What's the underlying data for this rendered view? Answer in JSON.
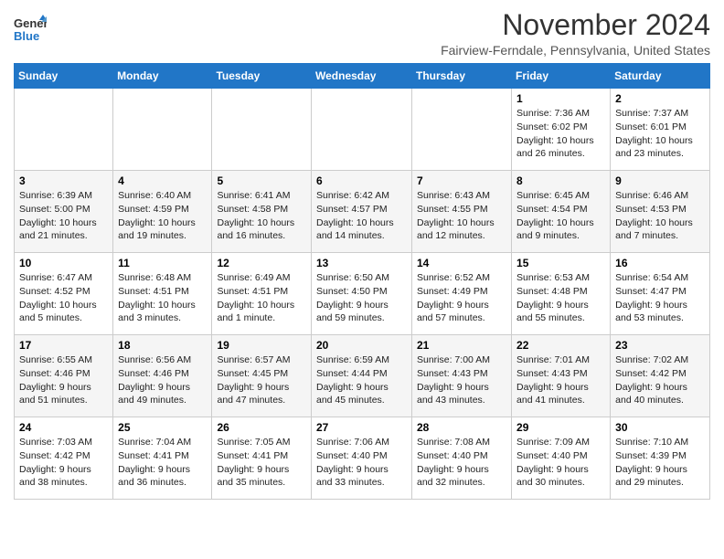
{
  "logo": {
    "line1": "General",
    "line2": "Blue"
  },
  "title": "November 2024",
  "location": "Fairview-Ferndale, Pennsylvania, United States",
  "days_of_week": [
    "Sunday",
    "Monday",
    "Tuesday",
    "Wednesday",
    "Thursday",
    "Friday",
    "Saturday"
  ],
  "weeks": [
    [
      {
        "day": "",
        "info": ""
      },
      {
        "day": "",
        "info": ""
      },
      {
        "day": "",
        "info": ""
      },
      {
        "day": "",
        "info": ""
      },
      {
        "day": "",
        "info": ""
      },
      {
        "day": "1",
        "info": "Sunrise: 7:36 AM\nSunset: 6:02 PM\nDaylight: 10 hours and 26 minutes."
      },
      {
        "day": "2",
        "info": "Sunrise: 7:37 AM\nSunset: 6:01 PM\nDaylight: 10 hours and 23 minutes."
      }
    ],
    [
      {
        "day": "3",
        "info": "Sunrise: 6:39 AM\nSunset: 5:00 PM\nDaylight: 10 hours and 21 minutes."
      },
      {
        "day": "4",
        "info": "Sunrise: 6:40 AM\nSunset: 4:59 PM\nDaylight: 10 hours and 19 minutes."
      },
      {
        "day": "5",
        "info": "Sunrise: 6:41 AM\nSunset: 4:58 PM\nDaylight: 10 hours and 16 minutes."
      },
      {
        "day": "6",
        "info": "Sunrise: 6:42 AM\nSunset: 4:57 PM\nDaylight: 10 hours and 14 minutes."
      },
      {
        "day": "7",
        "info": "Sunrise: 6:43 AM\nSunset: 4:55 PM\nDaylight: 10 hours and 12 minutes."
      },
      {
        "day": "8",
        "info": "Sunrise: 6:45 AM\nSunset: 4:54 PM\nDaylight: 10 hours and 9 minutes."
      },
      {
        "day": "9",
        "info": "Sunrise: 6:46 AM\nSunset: 4:53 PM\nDaylight: 10 hours and 7 minutes."
      }
    ],
    [
      {
        "day": "10",
        "info": "Sunrise: 6:47 AM\nSunset: 4:52 PM\nDaylight: 10 hours and 5 minutes."
      },
      {
        "day": "11",
        "info": "Sunrise: 6:48 AM\nSunset: 4:51 PM\nDaylight: 10 hours and 3 minutes."
      },
      {
        "day": "12",
        "info": "Sunrise: 6:49 AM\nSunset: 4:51 PM\nDaylight: 10 hours and 1 minute."
      },
      {
        "day": "13",
        "info": "Sunrise: 6:50 AM\nSunset: 4:50 PM\nDaylight: 9 hours and 59 minutes."
      },
      {
        "day": "14",
        "info": "Sunrise: 6:52 AM\nSunset: 4:49 PM\nDaylight: 9 hours and 57 minutes."
      },
      {
        "day": "15",
        "info": "Sunrise: 6:53 AM\nSunset: 4:48 PM\nDaylight: 9 hours and 55 minutes."
      },
      {
        "day": "16",
        "info": "Sunrise: 6:54 AM\nSunset: 4:47 PM\nDaylight: 9 hours and 53 minutes."
      }
    ],
    [
      {
        "day": "17",
        "info": "Sunrise: 6:55 AM\nSunset: 4:46 PM\nDaylight: 9 hours and 51 minutes."
      },
      {
        "day": "18",
        "info": "Sunrise: 6:56 AM\nSunset: 4:46 PM\nDaylight: 9 hours and 49 minutes."
      },
      {
        "day": "19",
        "info": "Sunrise: 6:57 AM\nSunset: 4:45 PM\nDaylight: 9 hours and 47 minutes."
      },
      {
        "day": "20",
        "info": "Sunrise: 6:59 AM\nSunset: 4:44 PM\nDaylight: 9 hours and 45 minutes."
      },
      {
        "day": "21",
        "info": "Sunrise: 7:00 AM\nSunset: 4:43 PM\nDaylight: 9 hours and 43 minutes."
      },
      {
        "day": "22",
        "info": "Sunrise: 7:01 AM\nSunset: 4:43 PM\nDaylight: 9 hours and 41 minutes."
      },
      {
        "day": "23",
        "info": "Sunrise: 7:02 AM\nSunset: 4:42 PM\nDaylight: 9 hours and 40 minutes."
      }
    ],
    [
      {
        "day": "24",
        "info": "Sunrise: 7:03 AM\nSunset: 4:42 PM\nDaylight: 9 hours and 38 minutes."
      },
      {
        "day": "25",
        "info": "Sunrise: 7:04 AM\nSunset: 4:41 PM\nDaylight: 9 hours and 36 minutes."
      },
      {
        "day": "26",
        "info": "Sunrise: 7:05 AM\nSunset: 4:41 PM\nDaylight: 9 hours and 35 minutes."
      },
      {
        "day": "27",
        "info": "Sunrise: 7:06 AM\nSunset: 4:40 PM\nDaylight: 9 hours and 33 minutes."
      },
      {
        "day": "28",
        "info": "Sunrise: 7:08 AM\nSunset: 4:40 PM\nDaylight: 9 hours and 32 minutes."
      },
      {
        "day": "29",
        "info": "Sunrise: 7:09 AM\nSunset: 4:40 PM\nDaylight: 9 hours and 30 minutes."
      },
      {
        "day": "30",
        "info": "Sunrise: 7:10 AM\nSunset: 4:39 PM\nDaylight: 9 hours and 29 minutes."
      }
    ]
  ]
}
